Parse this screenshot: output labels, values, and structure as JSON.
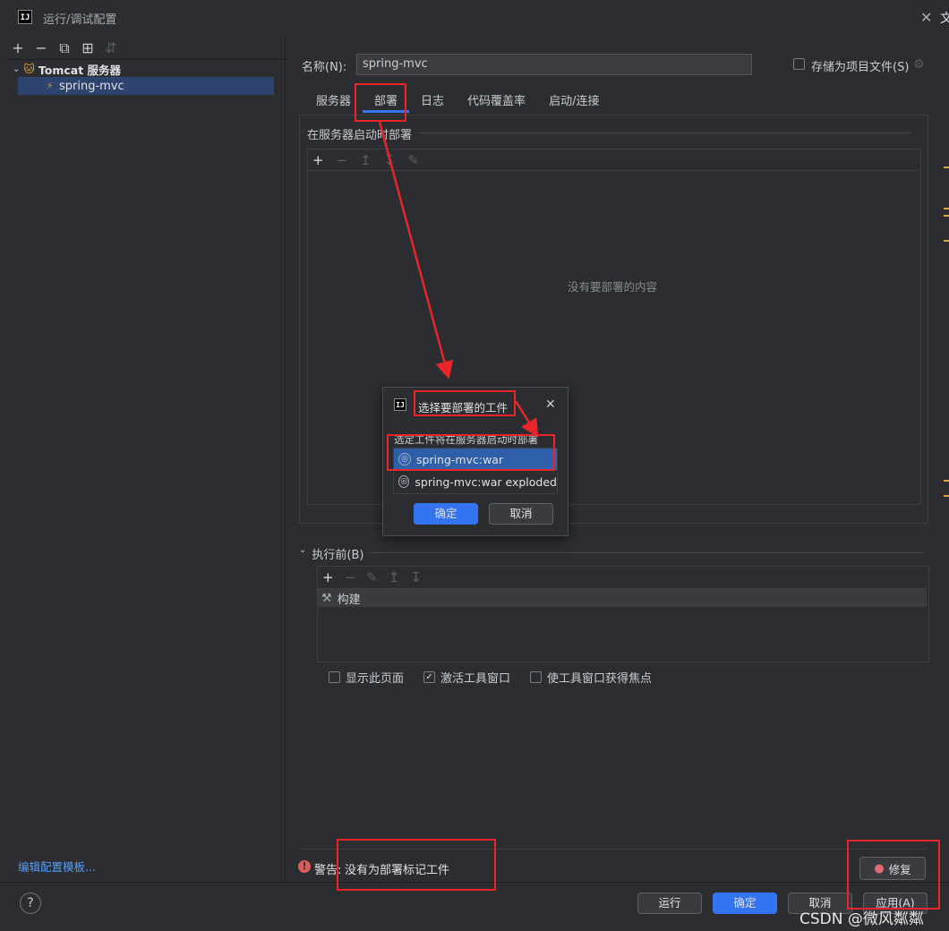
{
  "window": {
    "title": "运行/调试配置",
    "edge_char": "文"
  },
  "left_panel": {
    "toolbar": {
      "add": "+",
      "remove": "−",
      "copy": "⧉",
      "folder": "⊞",
      "sort": "⇵"
    },
    "tree": {
      "group_label": "Tomcat 服务器",
      "child_label": "spring-mvc"
    },
    "edit_templates_link": "编辑配置模板..."
  },
  "form": {
    "name_label": "名称(N):",
    "name_value": "spring-mvc",
    "store_as_project_file": "存储为项目文件(S)"
  },
  "tabs": [
    {
      "label": "服务器"
    },
    {
      "label": "部署"
    },
    {
      "label": "日志"
    },
    {
      "label": "代码覆盖率"
    },
    {
      "label": "启动/连接"
    }
  ],
  "deploy": {
    "section_title": "在服务器启动时部署",
    "empty_text": "没有要部署的内容"
  },
  "before_launch": {
    "title": "执行前(B)",
    "build_item": "构建",
    "checkboxes": [
      {
        "label": "显示此页面",
        "checked": false
      },
      {
        "label": "激活工具窗口",
        "checked": true
      },
      {
        "label": "使工具窗口获得焦点",
        "checked": false
      }
    ]
  },
  "warning": {
    "label": "警告:",
    "message": "没有为部署标记工件",
    "fix_button": "修复"
  },
  "footer": {
    "help": "?",
    "run": "运行",
    "ok": "确定",
    "cancel": "取消",
    "apply": "应用(A)"
  },
  "popup": {
    "title": "选择要部署的工件",
    "description": "选定工件将在服务器启动时部署",
    "items": [
      {
        "label": "spring-mvc:war",
        "selected": true
      },
      {
        "label": "spring-mvc:war exploded",
        "selected": false
      }
    ],
    "ok": "确定",
    "cancel": "取消"
  },
  "watermark": "CSDN @微风粼粼",
  "colors": {
    "accent": "#3574f0",
    "annotation": "#e8262a",
    "warning": "#db5c5c"
  }
}
